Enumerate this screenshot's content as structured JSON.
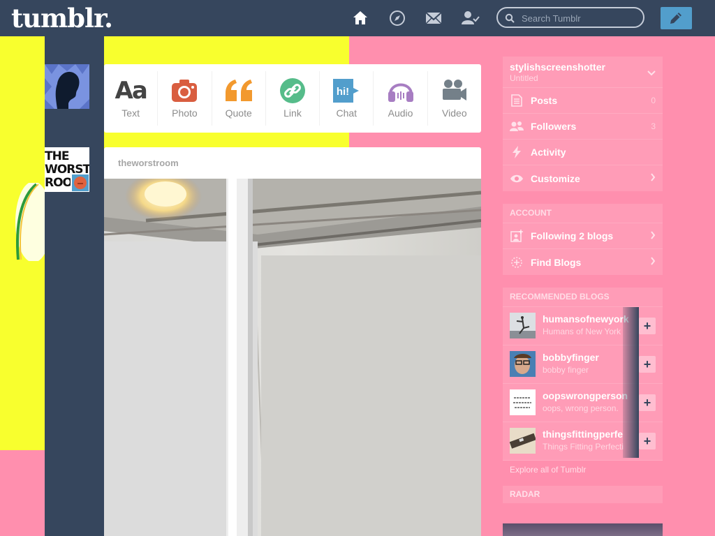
{
  "app": {
    "logo": "tumblr."
  },
  "topbar": {
    "nav": [
      {
        "icon": "home-icon"
      },
      {
        "icon": "compass-icon"
      },
      {
        "icon": "mail-icon"
      },
      {
        "icon": "account-icon"
      }
    ],
    "search_placeholder": "Search Tumblr",
    "compose_icon": "pencil-icon"
  },
  "post_types": [
    {
      "label": "Text",
      "icon": "text-icon",
      "color": "#444444"
    },
    {
      "label": "Photo",
      "icon": "camera-icon",
      "color": "#d95e40"
    },
    {
      "label": "Quote",
      "icon": "quote-icon",
      "color": "#f2992e"
    },
    {
      "label": "Link",
      "icon": "link-icon",
      "color": "#56bc8a"
    },
    {
      "label": "Chat",
      "icon": "chat-icon",
      "color": "#529ecc"
    },
    {
      "label": "Audio",
      "icon": "headphones-icon",
      "color": "#a77dc2"
    },
    {
      "label": "Video",
      "icon": "video-icon",
      "color": "#748089"
    }
  ],
  "post": {
    "blog_name": "theworstroom",
    "avatar_text": "THE WORST ROO"
  },
  "sidebar": {
    "blog": {
      "name": "stylishscreenshotter",
      "subtitle": "Untitled"
    },
    "blog_items": [
      {
        "label": "Posts",
        "count": "0",
        "icon": "posts-icon"
      },
      {
        "label": "Followers",
        "count": "3",
        "icon": "followers-icon"
      },
      {
        "label": "Activity",
        "count": "",
        "icon": "lightning-icon"
      },
      {
        "label": "Customize",
        "count": "",
        "icon": "eye-icon"
      }
    ],
    "account_title": "ACCOUNT",
    "account_items": [
      {
        "label": "Following 2 blogs",
        "icon": "following-icon"
      },
      {
        "label": "Find Blogs",
        "icon": "find-blogs-icon"
      }
    ],
    "recommended_title": "RECOMMENDED BLOGS",
    "recommended": [
      {
        "name": "humansofnewyork",
        "subtitle": "Humans of New York"
      },
      {
        "name": "bobbyfinger",
        "subtitle": "bobby finger"
      },
      {
        "name": "oopswrongperson",
        "subtitle": "oops, wrong person."
      },
      {
        "name": "thingsfittingperfe",
        "subtitle": "Things Fitting Perfecti"
      }
    ],
    "explore": "Explore all of Tumblr",
    "radar_title": "RADAR"
  },
  "colors": {
    "navy": "#36465d",
    "yellow": "#f8ff2e",
    "pink": "#ff8fae",
    "accent_blue": "#529ecc"
  }
}
